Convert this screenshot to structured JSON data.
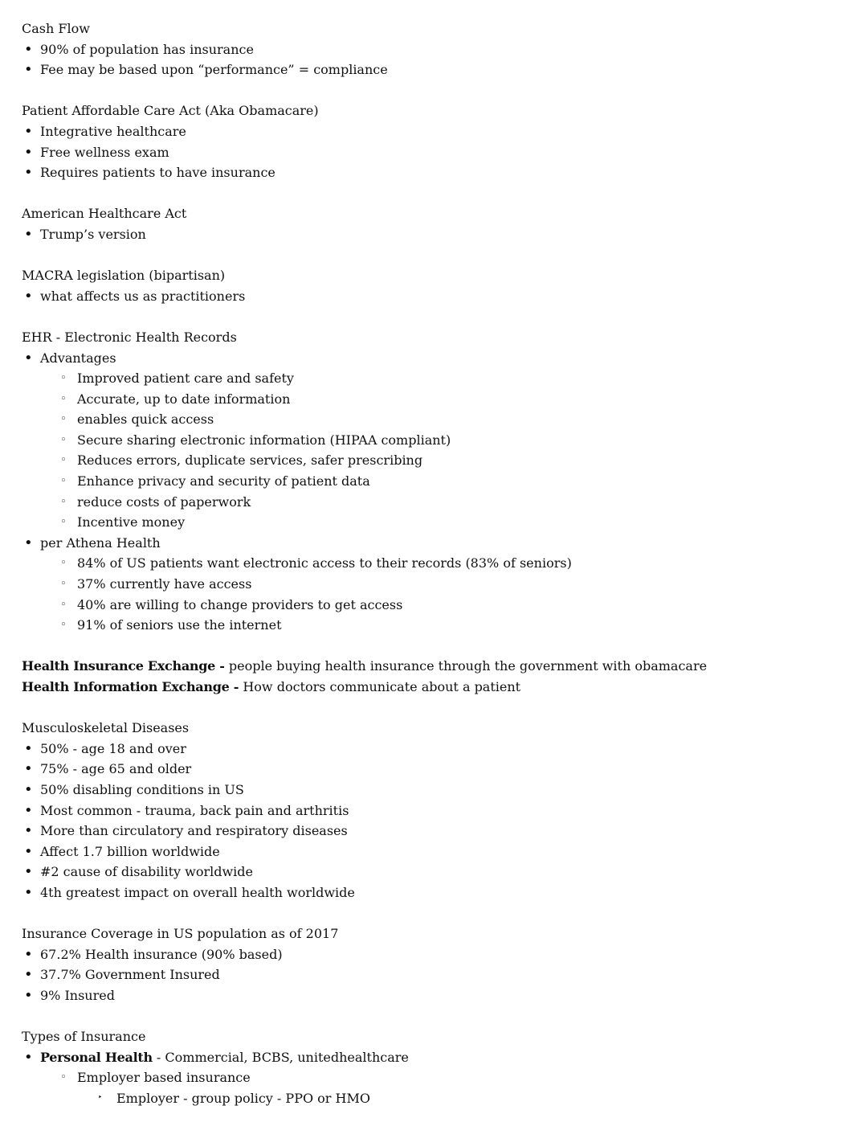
{
  "sections": [
    {
      "heading": "Cash Flow",
      "items": [
        {
          "level": 0,
          "text": "90% of population has insurance"
        },
        {
          "level": 0,
          "text": "Fee may be based upon “performance” = compliance"
        }
      ]
    },
    {
      "heading": "Patient Affordable Care Act (Aka Obamacare)",
      "items": [
        {
          "level": 0,
          "text": "Integrative healthcare"
        },
        {
          "level": 0,
          "text": "Free wellness exam"
        },
        {
          "level": 0,
          "text": "Requires patients to have insurance"
        }
      ]
    },
    {
      "heading": "American Healthcare Act",
      "items": [
        {
          "level": 0,
          "text": "Trump’s version"
        }
      ]
    },
    {
      "heading": "MACRA legislation (bipartisan)",
      "items": [
        {
          "level": 0,
          "text": "what affects us as practitioners"
        }
      ]
    },
    {
      "heading": "EHR - Electronic Health Records",
      "items": [
        {
          "level": 0,
          "text": "Advantages"
        },
        {
          "level": 1,
          "text": "Improved patient care and safety"
        },
        {
          "level": 1,
          "text": "Accurate, up to date information"
        },
        {
          "level": 1,
          "text": "enables quick access"
        },
        {
          "level": 1,
          "text": "Secure sharing electronic information (HIPAA compliant)"
        },
        {
          "level": 1,
          "text": "Reduces errors, duplicate services, safer prescribing"
        },
        {
          "level": 1,
          "text": "Enhance privacy and security of patient data"
        },
        {
          "level": 1,
          "text": "reduce costs of paperwork"
        },
        {
          "level": 1,
          "text": "Incentive money"
        },
        {
          "level": 0,
          "text": "per Athena Health"
        },
        {
          "level": 1,
          "text": "84% of US patients want electronic access to their records (83% of seniors)"
        },
        {
          "level": 1,
          "text": "37% currently have access"
        },
        {
          "level": 1,
          "text": "40% are willing to change providers to get access"
        },
        {
          "level": 1,
          "text": "91% of seniors use the internet"
        }
      ]
    },
    {
      "heading": "",
      "items": [
        {
          "level": -1,
          "bold": "Health Insurance Exchange - ",
          "text": "people buying health insurance through the government with obamacare"
        },
        {
          "level": -1,
          "bold": "Health Information Exchange - ",
          "text": "How doctors communicate about a patient"
        }
      ]
    },
    {
      "heading": "Musculoskeletal Diseases",
      "items": [
        {
          "level": 0,
          "text": "50% - age 18 and over"
        },
        {
          "level": 0,
          "text": "75% - age 65 and older"
        },
        {
          "level": 0,
          "text": "50% disabling conditions in US"
        },
        {
          "level": 0,
          "text": "Most common - trauma, back pain and arthritis"
        },
        {
          "level": 0,
          "text": "More than circulatory and respiratory diseases"
        },
        {
          "level": 0,
          "text": "Affect 1.7 billion worldwide"
        },
        {
          "level": 0,
          "text": "#2 cause of disability worldwide"
        },
        {
          "level": 0,
          "text": "4th greatest impact on overall health worldwide"
        }
      ]
    },
    {
      "heading": "Insurance Coverage in US population as of 2017",
      "items": [
        {
          "level": 0,
          "text": "67.2% Health insurance (90% based)"
        },
        {
          "level": 0,
          "text": "37.7% Government Insured"
        },
        {
          "level": 0,
          "text": "9% Insured"
        }
      ]
    },
    {
      "heading": "Types of Insurance",
      "items": [
        {
          "level": 0,
          "bold": "Personal Health",
          "text": " - Commercial, BCBS, unitedhealthcare"
        },
        {
          "level": 1,
          "text": "Employer based insurance"
        },
        {
          "level": 2,
          "text": "Employer - group policy - PPO or HMO"
        }
      ]
    }
  ],
  "bullets": {
    "0": "•",
    "1": "◦",
    "2": "‣"
  }
}
